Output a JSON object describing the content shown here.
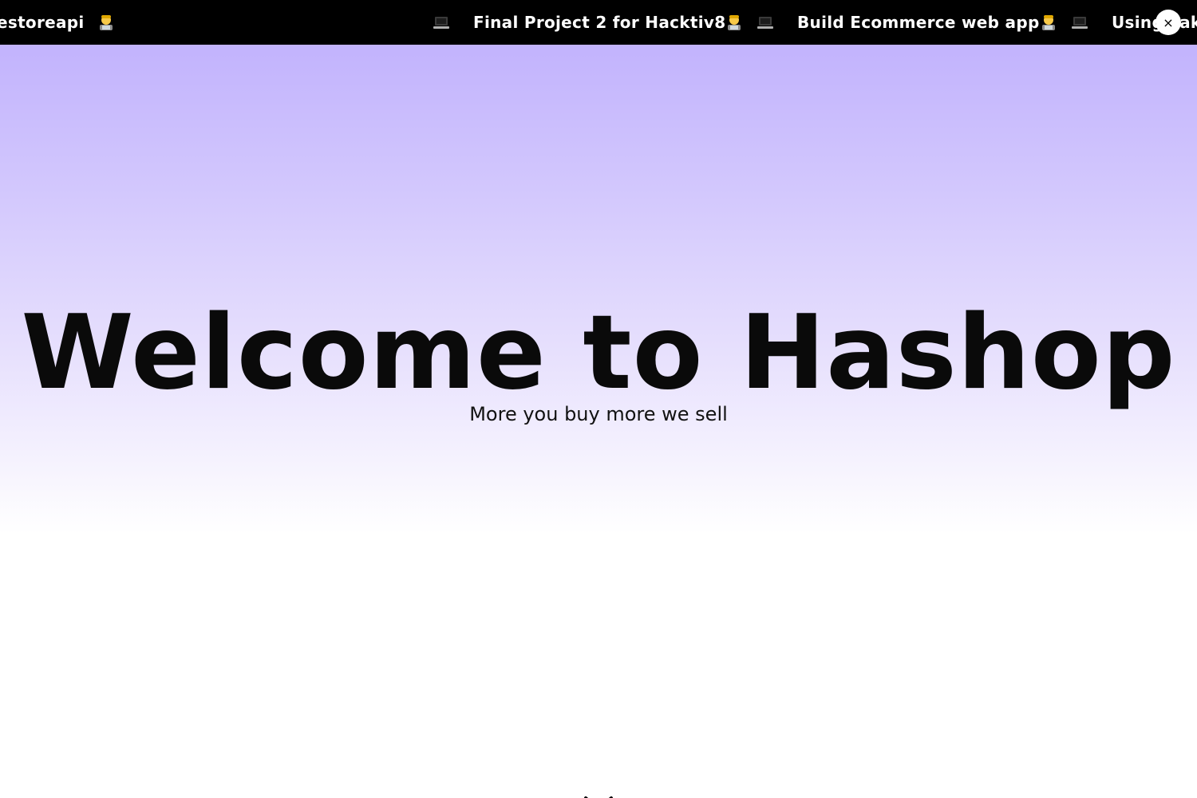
{
  "marquee": {
    "items": [
      {
        "text": "estoreapi"
      },
      {
        "text": "Final Project 2 for Hacktiv8"
      },
      {
        "text": "Build Ecommerce web app"
      },
      {
        "text": "Using Fake"
      }
    ],
    "icons": [
      "technologist-emoji-icon",
      "laptop-emoji-icon"
    ],
    "close_label": "×"
  },
  "hero": {
    "title": "Welcome to Hashop",
    "subtitle": "More you buy more we sell"
  },
  "colors": {
    "bar_bg": "#000000",
    "gradient_top": "#c2b3fd",
    "text": "#0a0a0a"
  }
}
